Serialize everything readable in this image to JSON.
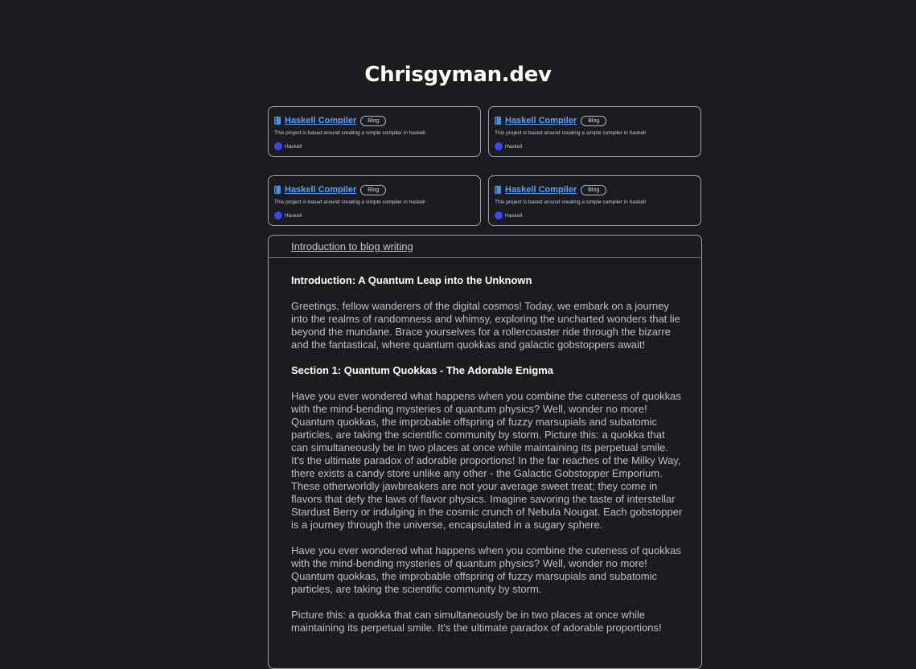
{
  "site": {
    "title": "Chrisgyman.dev"
  },
  "cards": [
    {
      "title": "Haskell Compiler",
      "badge": "Blog",
      "description": "This project is based around creating a simple compiler in haskell",
      "language": "Haskell",
      "language_color": "#3a46f0",
      "icon": "book-icon"
    },
    {
      "title": "Haskell Compiler",
      "badge": "Blog",
      "description": "This project is based around creating a simple compiler in haskell",
      "language": "Haskell",
      "language_color": "#3a46f0",
      "icon": "book-icon"
    },
    {
      "title": "Haskell Compiler",
      "badge": "Blog",
      "description": "This project is based around creating a simple compiler in haskell",
      "language": "Haskell",
      "language_color": "#3a46f0",
      "icon": "book-icon"
    },
    {
      "title": "Haskell Compiler",
      "badge": "Blog",
      "description": "This project is based around creating a simple compiler in haskell",
      "language": "Haskell",
      "language_color": "#3a46f0",
      "icon": "book-icon"
    }
  ],
  "article": {
    "link": "Introduction to blog writing",
    "heading1": "Introduction: A Quantum Leap into the Unknown",
    "para1": "Greetings, fellow wanderers of the digital cosmos! Today, we embark on a journey into the realms of randomness and whimsy, exploring the uncharted wonders that lie beyond the mundane. Brace yourselves for a rollercoaster ride through the bizarre and the fantastical, where quantum quokkas and galactic gobstoppers await!",
    "heading2": "Section 1: Quantum Quokkas - The Adorable Enigma",
    "para2": "Have you ever wondered what happens when you combine the cuteness of quokkas with the mind-bending mysteries of quantum physics? Well, wonder no more! Quantum quokkas, the improbable offspring of fuzzy marsupials and subatomic particles, are taking the scientific community by storm. Picture this: a quokka that can simultaneously be in two places at once while maintaining its perpetual smile. It's the ultimate paradox of adorable proportions! In the far reaches of the Milky Way, there exists a candy store unlike any other - the Galactic Gobstopper Emporium. These otherworldly jawbreakers are not your average sweet treat; they come in flavors that defy the laws of flavor physics. Imagine savoring the taste of interstellar Stardust Berry or indulging in the cosmic crunch of Nebula Nougat. Each gobstopper is a journey through the universe, encapsulated in a sugary sphere.",
    "para3": "Have you ever wondered what happens when you combine the cuteness of quokkas with the mind-bending mysteries of quantum physics? Well, wonder no more! Quantum quokkas, the improbable offspring of fuzzy marsupials and subatomic particles, are taking the scientific community by storm.",
    "para4": "Picture this: a quokka that can simultaneously be in two places at once while maintaining its perpetual smile. It's the ultimate paradox of adorable proportions!"
  }
}
